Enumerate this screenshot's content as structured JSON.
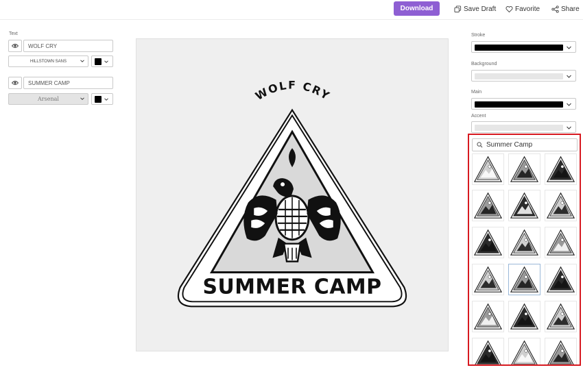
{
  "toolbar": {
    "download_label": "Download",
    "save_draft_label": "Save Draft",
    "favorite_label": "Favorite",
    "share_label": "Share"
  },
  "left_panel": {
    "section_label": "Text",
    "line1": {
      "value": "WOLF CRY",
      "font": "HILLSTOWN SANS",
      "color": "#000000"
    },
    "line2": {
      "value": "SUMMER CAMP",
      "font": "Arsenal",
      "color": "#000000"
    }
  },
  "canvas": {
    "top_text": "WOLF CRY",
    "bottom_text": "SUMMER CAMP",
    "background": "#efefef"
  },
  "right_panel": {
    "stroke_label": "Stroke",
    "stroke_color": "#000000",
    "background_label": "Background",
    "background_color": "#e6e6e6",
    "main_label": "Main",
    "main_color": "#000000",
    "accent_label": "Accent",
    "accent_color": "#e6e6e6",
    "search_value": "Summer Camp",
    "gallery_icons": [
      "bear",
      "bear",
      "owl",
      "mountain",
      "mountain-moon",
      "paw",
      "tent",
      "tent",
      "bear-moon",
      "mountain-van",
      "bird",
      "wolf-howl",
      "canyon",
      "tree",
      "pine-trees",
      "mountain",
      "tent",
      "tent"
    ]
  }
}
